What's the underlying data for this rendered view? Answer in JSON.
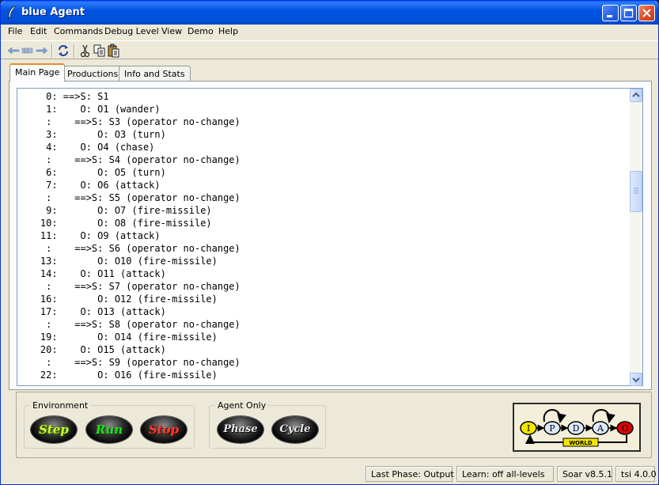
{
  "window": {
    "title": "blue Agent"
  },
  "menu": {
    "items": [
      "File",
      "Edit",
      "Commands",
      "Debug Level",
      "View",
      "Demo",
      "Help"
    ]
  },
  "toolbar": {
    "icons": [
      "back-arrow-icon",
      "history-icon",
      "forward-arrow-icon",
      "refresh-icon",
      "cut-icon",
      "copy-icon",
      "paste-icon"
    ]
  },
  "tabs": [
    {
      "label": "Main Page",
      "active": true
    },
    {
      "label": "Productions",
      "active": false
    },
    {
      "label": "Info and Stats",
      "active": false
    }
  ],
  "console": {
    "lines": [
      "     0: ==>S: S1",
      "     1:    O: O1 (wander)",
      "     :    ==>S: S3 (operator no-change)",
      "     3:       O: O3 (turn)",
      "     4:    O: O4 (chase)",
      "     :    ==>S: S4 (operator no-change)",
      "     6:       O: O5 (turn)",
      "     7:    O: O6 (attack)",
      "     :    ==>S: S5 (operator no-change)",
      "     9:       O: O7 (fire-missile)",
      "    10:       O: O8 (fire-missile)",
      "    11:    O: O9 (attack)",
      "     :    ==>S: S6 (operator no-change)",
      "    13:       O: O10 (fire-missile)",
      "    14:    O: O11 (attack)",
      "     :    ==>S: S7 (operator no-change)",
      "    16:       O: O12 (fire-missile)",
      "    17:    O: O13 (attack)",
      "     :    ==>S: S8 (operator no-change)",
      "    19:       O: O14 (fire-missile)",
      "    20:    O: O15 (attack)",
      "     :    ==>S: S9 (operator no-change)",
      "    22:       O: O16 (fire-missile)"
    ]
  },
  "environment": {
    "label": "Environment",
    "buttons": [
      "Step",
      "Run",
      "Stop"
    ]
  },
  "agent_only": {
    "label": "Agent Only",
    "buttons": [
      "Phase",
      "Cycle"
    ]
  },
  "phase_diagram": {
    "nodes": [
      "I",
      "P",
      "D",
      "A",
      "O"
    ],
    "world_label": "WORLD"
  },
  "status": {
    "last_phase": "Last Phase: Output",
    "learn": "Learn: off  all-levels",
    "soar_version": "Soar v8.5.1",
    "tsi_version": "tsi 4.0.0"
  },
  "colors": {
    "titlebar": "#0054E3",
    "window_bg": "#ECE9D8",
    "active_tab_accent": "#E68B2C",
    "input_node": "#F2E600",
    "output_node": "#E00000"
  }
}
